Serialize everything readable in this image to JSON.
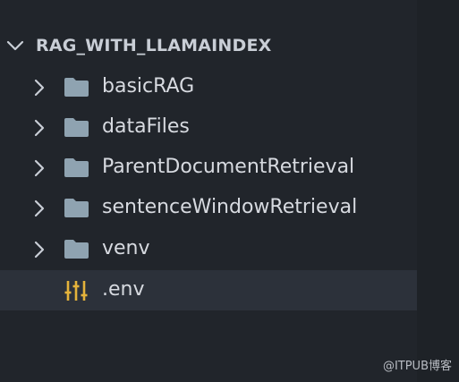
{
  "explorer": {
    "project_title": "RAG_WITH_LLAMAINDEX",
    "items": [
      {
        "label": "basicRAG",
        "type": "folder"
      },
      {
        "label": "dataFiles",
        "type": "folder"
      },
      {
        "label": "ParentDocumentRetrieval",
        "type": "folder"
      },
      {
        "label": "sentenceWindowRetrieval",
        "type": "folder"
      },
      {
        "label": "venv",
        "type": "folder"
      },
      {
        "label": ".env",
        "type": "file",
        "icon": "settings-sliders-icon"
      }
    ]
  },
  "colors": {
    "background": "#21252b",
    "selected_row": "#2c313a",
    "folder_icon": "#8fa3b1",
    "env_icon": "#e5b33b",
    "text": "#d7dae0"
  },
  "watermark": "@ITPUB博客"
}
